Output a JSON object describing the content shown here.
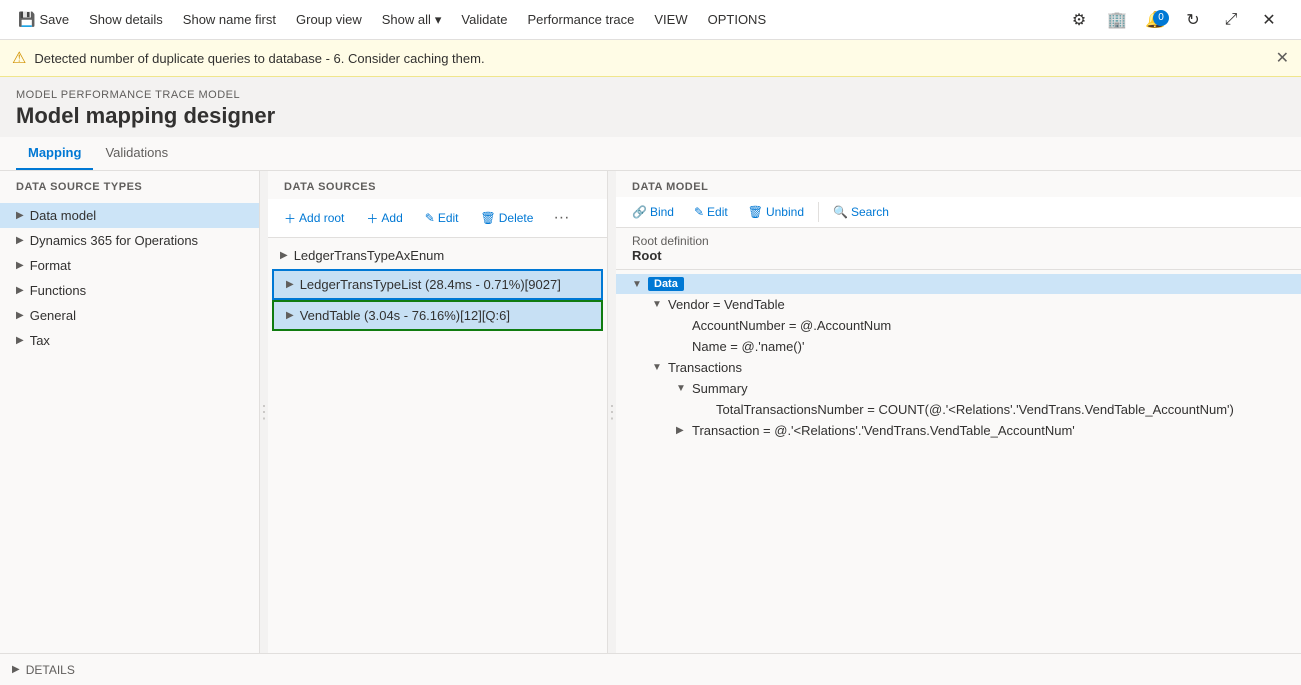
{
  "toolbar": {
    "save_label": "Save",
    "show_details_label": "Show details",
    "show_name_first_label": "Show name first",
    "group_view_label": "Group view",
    "show_all_label": "Show all",
    "validate_label": "Validate",
    "performance_trace_label": "Performance trace",
    "view_label": "VIEW",
    "options_label": "OPTIONS"
  },
  "alert": {
    "message": "Detected number of duplicate queries to database - 6. Consider caching them."
  },
  "breadcrumb": "MODEL PERFORMANCE TRACE MODEL",
  "page_title": "Model mapping designer",
  "tabs": [
    {
      "label": "Mapping",
      "active": true
    },
    {
      "label": "Validations",
      "active": false
    }
  ],
  "data_source_types": {
    "header": "DATA SOURCE TYPES",
    "items": [
      {
        "label": "Data model",
        "selected": true
      },
      {
        "label": "Dynamics 365 for Operations",
        "selected": false
      },
      {
        "label": "Format",
        "selected": false
      },
      {
        "label": "Functions",
        "selected": false
      },
      {
        "label": "General",
        "selected": false
      },
      {
        "label": "Tax",
        "selected": false
      }
    ]
  },
  "data_sources": {
    "header": "DATA SOURCES",
    "add_root_label": "Add root",
    "add_label": "Add",
    "edit_label": "Edit",
    "delete_label": "Delete",
    "items": [
      {
        "label": "LedgerTransTypeAxEnum",
        "highlighted": false,
        "highlighted_green": false
      },
      {
        "label": "LedgerTransTypeList (28.4ms - 0.71%)[9027]",
        "highlighted": true,
        "highlighted_green": false
      },
      {
        "label": "VendTable (3.04s - 76.16%)[12][Q:6]",
        "highlighted": false,
        "highlighted_green": true
      }
    ]
  },
  "data_model": {
    "header": "DATA MODEL",
    "bind_label": "Bind",
    "edit_label": "Edit",
    "unbind_label": "Unbind",
    "search_label": "Search",
    "root_definition_label": "Root definition",
    "root_value": "Root",
    "tree": [
      {
        "level": 0,
        "label": "Data",
        "type": "box",
        "expanded": true,
        "selected": true,
        "chevron": "down"
      },
      {
        "level": 1,
        "label": "Vendor = VendTable",
        "expanded": true,
        "chevron": "down"
      },
      {
        "level": 2,
        "label": "AccountNumber = @.AccountNum",
        "expanded": false,
        "chevron": ""
      },
      {
        "level": 2,
        "label": "Name = @.'name()'",
        "expanded": false,
        "chevron": ""
      },
      {
        "level": 1,
        "label": "Transactions",
        "expanded": true,
        "chevron": "down"
      },
      {
        "level": 2,
        "label": "Summary",
        "expanded": true,
        "chevron": "down"
      },
      {
        "level": 3,
        "label": "TotalTransactionsNumber = COUNT(@.'<Relations'.'VendTrans.VendTable_AccountNum')",
        "expanded": false,
        "chevron": ""
      },
      {
        "level": 2,
        "label": "Transaction = @.'<Relations'.'VendTrans.VendTable_AccountNum'",
        "expanded": false,
        "chevron": "right"
      }
    ]
  },
  "details_bar": {
    "label": "DETAILS"
  }
}
